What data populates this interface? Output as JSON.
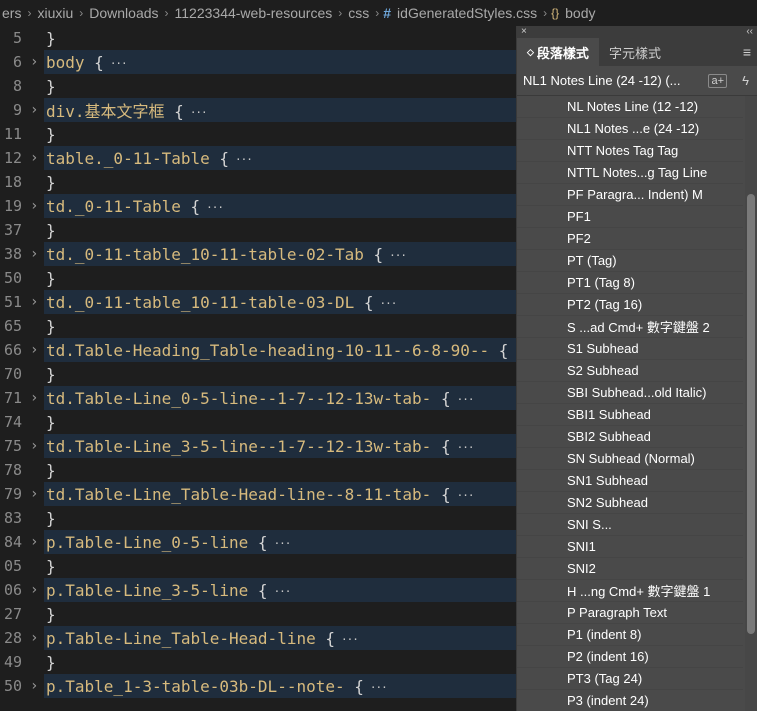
{
  "breadcrumb": {
    "segments": [
      "ers",
      "xiuxiu",
      "Downloads",
      "11223344-web-resources",
      "css"
    ],
    "file": "idGeneratedStyles.css",
    "symbol": "body"
  },
  "editor": {
    "lines": [
      {
        "num": "5",
        "text": "}",
        "fold": false,
        "hl": false
      },
      {
        "num": "6",
        "text": "body ",
        "fold": true,
        "hl": true
      },
      {
        "num": "8",
        "text": "}",
        "fold": false,
        "hl": false
      },
      {
        "num": "9",
        "text": "div.基本文字框 ",
        "fold": true,
        "hl": true
      },
      {
        "num": "11",
        "text": "}",
        "fold": false,
        "hl": false
      },
      {
        "num": "12",
        "text": "table._0-11-Table ",
        "fold": true,
        "hl": true
      },
      {
        "num": "18",
        "text": "}",
        "fold": false,
        "hl": false
      },
      {
        "num": "19",
        "text": "td._0-11-Table ",
        "fold": true,
        "hl": true
      },
      {
        "num": "37",
        "text": "}",
        "fold": false,
        "hl": false
      },
      {
        "num": "38",
        "text": "td._0-11-table_10-11-table-02-Tab ",
        "fold": true,
        "hl": true
      },
      {
        "num": "50",
        "text": "}",
        "fold": false,
        "hl": false
      },
      {
        "num": "51",
        "text": "td._0-11-table_10-11-table-03-DL ",
        "fold": true,
        "hl": true
      },
      {
        "num": "65",
        "text": "}",
        "fold": false,
        "hl": false
      },
      {
        "num": "66",
        "text": "td.Table-Heading_Table-heading-10-11--6-8-90-- ",
        "fold": true,
        "hl": true
      },
      {
        "num": "70",
        "text": "}",
        "fold": false,
        "hl": false
      },
      {
        "num": "71",
        "text": "td.Table-Line_0-5-line--1-7--12-13w-tab- ",
        "fold": true,
        "hl": true
      },
      {
        "num": "74",
        "text": "}",
        "fold": false,
        "hl": false
      },
      {
        "num": "75",
        "text": "td.Table-Line_3-5-line--1-7--12-13w-tab- ",
        "fold": true,
        "hl": true
      },
      {
        "num": "78",
        "text": "}",
        "fold": false,
        "hl": false
      },
      {
        "num": "79",
        "text": "td.Table-Line_Table-Head-line--8-11-tab- ",
        "fold": true,
        "hl": true
      },
      {
        "num": "83",
        "text": "}",
        "fold": false,
        "hl": false
      },
      {
        "num": "84",
        "text": "p.Table-Line_0-5-line ",
        "fold": true,
        "hl": true
      },
      {
        "num": "05",
        "text": "}",
        "fold": false,
        "hl": false
      },
      {
        "num": "06",
        "text": "p.Table-Line_3-5-line ",
        "fold": true,
        "hl": true
      },
      {
        "num": "27",
        "text": "}",
        "fold": false,
        "hl": false
      },
      {
        "num": "28",
        "text": "p.Table-Line_Table-Head-line ",
        "fold": true,
        "hl": true
      },
      {
        "num": "49",
        "text": "}",
        "fold": false,
        "hl": false
      },
      {
        "num": "50",
        "text": "p.Table_1-3-table-03b-DL--note- ",
        "fold": true,
        "hl": true
      }
    ],
    "brace": "{",
    "ellipsis": "···"
  },
  "panel": {
    "close_glyph": "×",
    "collapse_glyph": "‹‹",
    "tabs": [
      {
        "label": "段落樣式",
        "active": true
      },
      {
        "label": "字元樣式",
        "active": false
      }
    ],
    "menu_glyph": "≡",
    "current_style": "NL1 Notes Line (24 -12) (...",
    "new_style_glyph": "a+",
    "bolt_glyph": "ϟ",
    "styles": [
      "NL Notes Line (12 -12)",
      "NL1 Notes ...e (24 -12)",
      "NTT Notes Tag Tag",
      "NTTL Notes...g Tag Line",
      "PF Paragra... Indent) M",
      "PF1",
      "PF2",
      "PT (Tag)",
      "PT1 (Tag 8)",
      "PT2 (Tag 16)",
      "S ...ad   Cmd+ 數字鍵盤 2",
      "S1 Subhead",
      "S2 Subhead",
      "SBI Subhead...old Italic)",
      "SBI1 Subhead",
      "SBI2 Subhead",
      "SN Subhead (Normal)",
      "SN1 Subhead",
      "SN2 Subhead",
      "SNI S...",
      "SNI1",
      "SNI2",
      "H ...ng   Cmd+ 數字鍵盤 1",
      "P Paragraph Text",
      "P1 (indent 8)",
      "P2 (indent 16)",
      "PT3 (Tag 24)",
      "P3 (indent 24)"
    ]
  }
}
